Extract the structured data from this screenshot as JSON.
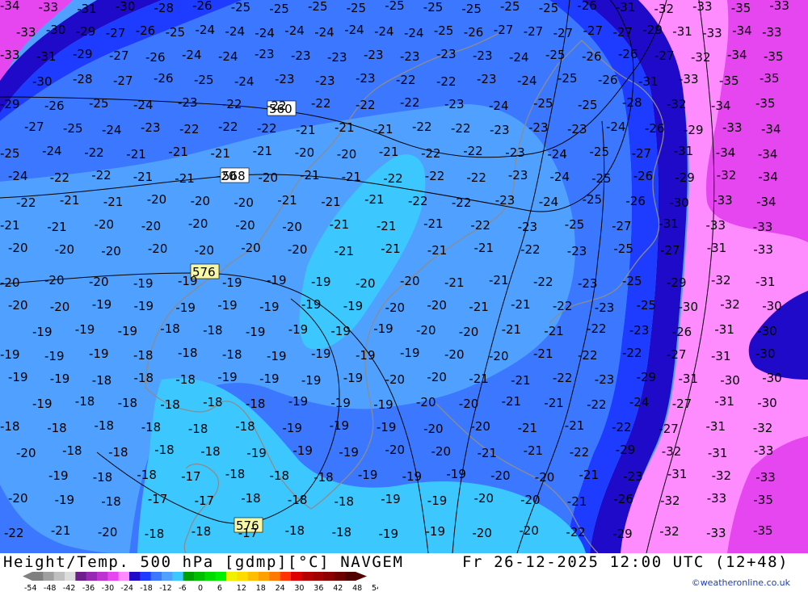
{
  "footer": {
    "title": "Height/Temp. 500 hPa [gdmp][°C] NAVGEM",
    "valid_time": "Fr 26-12-2025 12:00 UTC (12+48)",
    "credit": "©weatheronline.co.uk"
  },
  "legend": {
    "ticks": [
      "-54",
      "-48",
      "-42",
      "-36",
      "-30",
      "-24",
      "-18",
      "-12",
      "-6",
      "0",
      "6",
      "12",
      "18",
      "24",
      "30",
      "36",
      "42",
      "48",
      "54"
    ],
    "colors": [
      "#808080",
      "#a0a0a0",
      "#c0c0c0",
      "#dcdcdc",
      "#6e1e8c",
      "#9628b4",
      "#be32d2",
      "#e646f0",
      "#ff8cff",
      "#1e0ac8",
      "#1e3cff",
      "#3c78ff",
      "#50a0ff",
      "#3cc8ff",
      "#00a000",
      "#00be00",
      "#00dc00",
      "#00f000",
      "#f0f000",
      "#ffdc00",
      "#ffbe00",
      "#ffa000",
      "#ff7800",
      "#ff3200",
      "#dc0000",
      "#b40000",
      "#a00000",
      "#8c0000",
      "#6e0000",
      "#500000"
    ]
  },
  "map": {
    "temperature_fill_colors": {
      "t_neg36_neg30": "#ff8cff",
      "t_neg30_neg28": "#1e0ac8",
      "t_neg28_neg24": "#1e3cff",
      "t_neg24_neg20": "#3c78ff",
      "t_neg20_neg18": "#50a0ff",
      "t_neg18_neg16": "#3cc8ff",
      "t_below_neg36": "#e646f0"
    },
    "height_labels": [
      "560",
      "568",
      "576",
      "576"
    ],
    "temp_labels": [
      "-34",
      "-33",
      "-31",
      "-30",
      "-28",
      "-26",
      "-25",
      "-25",
      "-25",
      "-25",
      "-25",
      "-25",
      "-25",
      "-25",
      "-25",
      "-26",
      "-31",
      "-32",
      "-33",
      "-35",
      "-33",
      "-33",
      "-30",
      "-29",
      "-27",
      "-26",
      "-25",
      "-24",
      "-24",
      "-24",
      "-24",
      "-24",
      "-24",
      "-24",
      "-24",
      "-25",
      "-26",
      "-27",
      "-27",
      "-27",
      "-27",
      "-27",
      "-29",
      "-31",
      "-33",
      "-34",
      "-33",
      "-33",
      "-31",
      "-29",
      "-27",
      "-26",
      "-24",
      "-24",
      "-23",
      "-23",
      "-23",
      "-23",
      "-23",
      "-23",
      "-23",
      "-24",
      "-25",
      "-26",
      "-26",
      "-27",
      "-32",
      "-34",
      "-35",
      "-30",
      "-28",
      "-27",
      "-26",
      "-25",
      "-24",
      "-23",
      "-23",
      "-23",
      "-22",
      "-22",
      "-23",
      "-24",
      "-25",
      "-26",
      "-31",
      "-33",
      "-35",
      "-35",
      "-29",
      "-26",
      "-25",
      "-24",
      "-23",
      "-22",
      "-22",
      "-22",
      "-22",
      "-22",
      "-23",
      "-24",
      "-25",
      "-25",
      "-28",
      "-32",
      "-34",
      "-35",
      "-27",
      "-25",
      "-24",
      "-23",
      "-22",
      "-22",
      "-22",
      "-21",
      "-21",
      "-21",
      "-22",
      "-22",
      "-23",
      "-23",
      "-23",
      "-24",
      "-26",
      "-29",
      "-33",
      "-34",
      "-25",
      "-24",
      "-22",
      "-21",
      "-21",
      "-21",
      "-21",
      "-20",
      "-20",
      "-21",
      "-22",
      "-22",
      "-23",
      "-24",
      "-25",
      "-27",
      "-31",
      "-34",
      "-34",
      "-24",
      "-22",
      "-22",
      "-21",
      "-21",
      "-20",
      "-20",
      "-21",
      "-21",
      "-22",
      "-22",
      "-22",
      "-23",
      "-24",
      "-25",
      "-26",
      "-29",
      "-32",
      "-34",
      "-22",
      "-21",
      "-21",
      "-20",
      "-20",
      "-20",
      "-21",
      "-21",
      "-21",
      "-22",
      "-22",
      "-23",
      "-24",
      "-25",
      "-26",
      "-30",
      "-33",
      "-34",
      "-21",
      "-21",
      "-20",
      "-20",
      "-20",
      "-20",
      "-20",
      "-21",
      "-21",
      "-21",
      "-22",
      "-23",
      "-25",
      "-27",
      "-31",
      "-33",
      "-33",
      "-20",
      "-20",
      "-20",
      "-20",
      "-20",
      "-20",
      "-20",
      "-21",
      "-21",
      "-21",
      "-21",
      "-22",
      "-23",
      "-25",
      "-27",
      "-31",
      "-33",
      "-20",
      "-20",
      "-20",
      "-19",
      "-19",
      "-19",
      "-19",
      "-19",
      "-20",
      "-20",
      "-21",
      "-21",
      "-22",
      "-23",
      "-25",
      "-29",
      "-32",
      "-31",
      "-20",
      "-20",
      "-19",
      "-19",
      "-19",
      "-19",
      "-19",
      "-19",
      "-19",
      "-20",
      "-20",
      "-21",
      "-21",
      "-22",
      "-23",
      "-25",
      "-30",
      "-32",
      "-30",
      "-19",
      "-19",
      "-19",
      "-18",
      "-18",
      "-19",
      "-19",
      "-19",
      "-19",
      "-20",
      "-20",
      "-21",
      "-21",
      "-22",
      "-23",
      "-26",
      "-31",
      "-30",
      "-19",
      "-19",
      "-19",
      "-18",
      "-18",
      "-18",
      "-19",
      "-19",
      "-19",
      "-19",
      "-20",
      "-20",
      "-21",
      "-22",
      "-22",
      "-27",
      "-31",
      "-30",
      "-19",
      "-19",
      "-18",
      "-18",
      "-18",
      "-19",
      "-19",
      "-19",
      "-19",
      "-20",
      "-20",
      "-21",
      "-21",
      "-22",
      "-23",
      "-29",
      "-31",
      "-30",
      "-30",
      "-19",
      "-18",
      "-18",
      "-18",
      "-18",
      "-18",
      "-19",
      "-19",
      "-19",
      "-20",
      "-20",
      "-21",
      "-21",
      "-22",
      "-24",
      "-27",
      "-31",
      "-30",
      "-18",
      "-18",
      "-18",
      "-18",
      "-18",
      "-18",
      "-19",
      "-19",
      "-19",
      "-20",
      "-20",
      "-21",
      "-21",
      "-22",
      "-27",
      "-31",
      "-32",
      "-20",
      "-18",
      "-18",
      "-18",
      "-18",
      "-19",
      "-19",
      "-19",
      "-20",
      "-20",
      "-21",
      "-21",
      "-22",
      "-29",
      "-32",
      "-31",
      "-33",
      "-19",
      "-18",
      "-18",
      "-17",
      "-18",
      "-18",
      "-18",
      "-19",
      "-19",
      "-19",
      "-20",
      "-20",
      "-21",
      "-23",
      "-31",
      "-32",
      "-33",
      "-20",
      "-19",
      "-18",
      "-17",
      "-17",
      "-18",
      "-18",
      "-18",
      "-19",
      "-19",
      "-20",
      "-20",
      "-21",
      "-26",
      "-32",
      "-33",
      "-35",
      "-22",
      "-21",
      "-20",
      "-18",
      "-18",
      "-17",
      "-18",
      "-18",
      "-19",
      "-19",
      "-20",
      "-20",
      "-22",
      "-29",
      "-32",
      "-33",
      "-35"
    ]
  }
}
